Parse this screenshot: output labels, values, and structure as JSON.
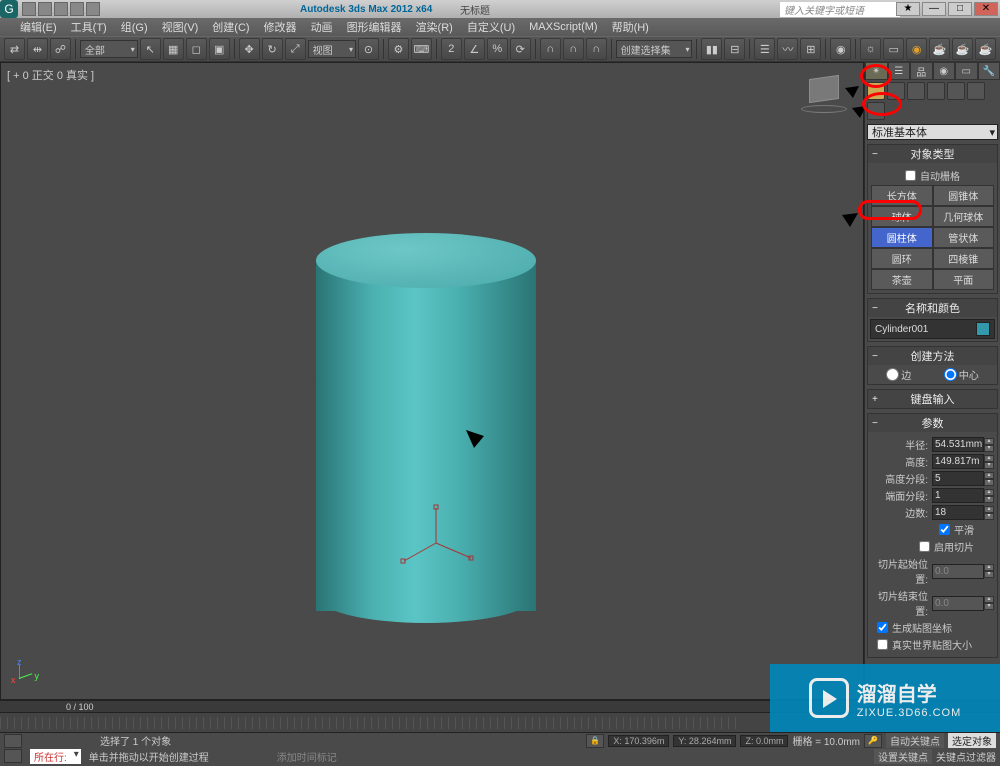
{
  "title": {
    "app": "Autodesk 3ds Max 2012 x64",
    "doc": "无标题",
    "search_placeholder": "键入关键字或短语"
  },
  "window_buttons": {
    "min": "—",
    "max": "□",
    "close": "✕"
  },
  "menu": {
    "items": [
      "编辑(E)",
      "工具(T)",
      "组(G)",
      "视图(V)",
      "创建(C)",
      "修改器",
      "动画",
      "图形编辑器",
      "渲染(R)",
      "自定义(U)",
      "MAXScript(M)",
      "帮助(H)"
    ]
  },
  "toolbar": {
    "scope": "全部",
    "view": "视图",
    "selection_mode": "创建选择集"
  },
  "viewport": {
    "label": "[ + 0 正交 0 真实 ]"
  },
  "panel": {
    "dropdown": "标准基本体",
    "object_type_head": "对象类型",
    "auto_grid": "自动栅格",
    "objects": [
      "长方体",
      "圆锥体",
      "球体",
      "几何球体",
      "圆柱体",
      "管状体",
      "圆环",
      "四棱锥",
      "茶壶",
      "平面"
    ],
    "selected": "圆柱体",
    "name_head": "名称和颜色",
    "name_value": "Cylinder001",
    "method_head": "创建方法",
    "method_edge": "边",
    "method_center": "中心",
    "keyboard_head": "键盘输入",
    "params_head": "参数",
    "radius_label": "半径:",
    "radius_value": "54.531mm",
    "height_label": "高度:",
    "height_value": "149.817m",
    "hseg_label": "高度分段:",
    "hseg_value": "5",
    "cseg_label": "端面分段:",
    "cseg_value": "1",
    "sides_label": "边数:",
    "sides_value": "18",
    "smooth": "平滑",
    "slice_on": "启用切片",
    "slice_from_label": "切片起始位置:",
    "slice_from_value": "0.0",
    "slice_to_label": "切片结束位置:",
    "slice_to_value": "0.0",
    "gen_uv": "生成贴图坐标",
    "real_world": "真实世界贴图大小"
  },
  "slider": {
    "frames": "0 / 100"
  },
  "status": {
    "selection": "选择了 1 个对象",
    "hint": "单击并拖动以开始创建过程",
    "x": "X: 170.396m",
    "y": "Y: 28.264mm",
    "z": "Z: 0.0mm",
    "grid": "栅格 = 10.0mm",
    "auto_key": "自动关键点",
    "sel_set": "选定对象",
    "set_key": "设置关键点",
    "key_filter": "关键点过滤器",
    "add_time": "添加时间标记",
    "current_row": "所在行:"
  },
  "watermark": {
    "title": "溜溜自学",
    "url": "ZIXUE.3D66.COM"
  }
}
